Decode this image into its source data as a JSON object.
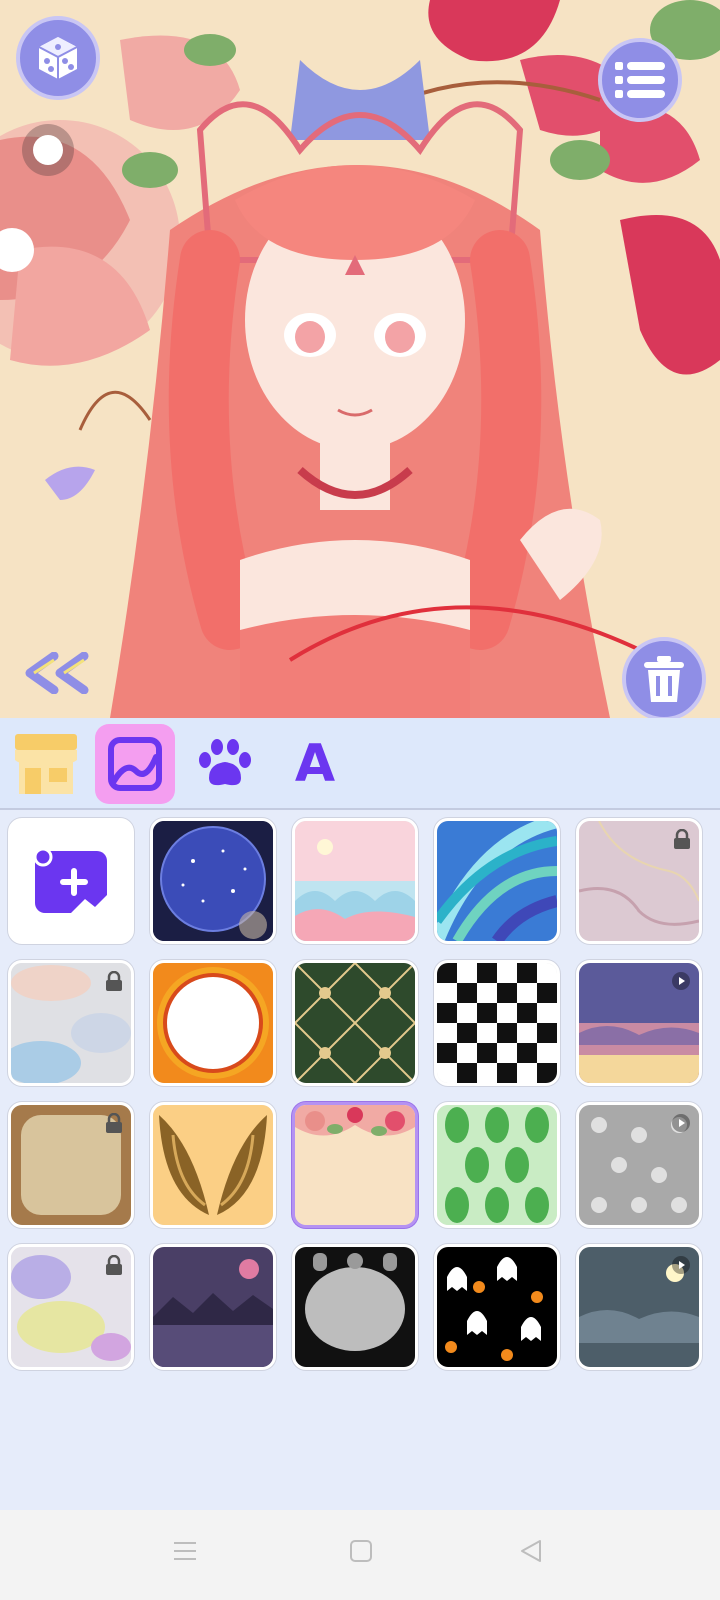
{
  "preview": {
    "dice_icon": "dice-icon",
    "menu_icon": "list-menu-icon",
    "trash_icon": "trash-icon",
    "collapse_icon": "double-chevron-left-icon",
    "toggle_state": "off"
  },
  "tabs": [
    {
      "name": "shop",
      "icon": "shop-icon",
      "active": false
    },
    {
      "name": "backgrounds",
      "icon": "background-image-icon",
      "active": true
    },
    {
      "name": "pets",
      "icon": "paw-icon",
      "active": false
    },
    {
      "name": "text",
      "icon": "letter-a-icon",
      "label": "A",
      "active": false
    }
  ],
  "backgrounds": [
    {
      "id": "upload",
      "kind": "upload-custom",
      "icon": "add-image-icon"
    },
    {
      "id": "galaxy-sphere",
      "locked": false
    },
    {
      "id": "pastel-clouds",
      "locked": false
    },
    {
      "id": "blue-swirl",
      "locked": false
    },
    {
      "id": "pink-marble",
      "locked": true
    },
    {
      "id": "watercolor",
      "locked": true
    },
    {
      "id": "orange-mandala-frame",
      "locked": false
    },
    {
      "id": "green-art-deco",
      "locked": false
    },
    {
      "id": "checkerboard",
      "locked": false
    },
    {
      "id": "sunset-sky",
      "locked": false,
      "video": true
    },
    {
      "id": "old-paper",
      "locked": true
    },
    {
      "id": "golden-wings",
      "locked": false
    },
    {
      "id": "floral-frame",
      "locked": false,
      "selected": true
    },
    {
      "id": "green-leaves",
      "locked": false
    },
    {
      "id": "grey-skulls",
      "locked": false,
      "video": true
    },
    {
      "id": "purple-splash",
      "locked": true
    },
    {
      "id": "night-lake",
      "locked": false
    },
    {
      "id": "graveyard-frame",
      "locked": false
    },
    {
      "id": "halloween-ghosts",
      "locked": false
    },
    {
      "id": "night-clouds",
      "locked": false,
      "video": true
    }
  ],
  "navbar": {
    "recent_icon": "recent-apps-icon",
    "home_icon": "home-icon",
    "back_icon": "back-icon"
  },
  "colors": {
    "accent": "#8f8ee6",
    "active_tab": "#f49ef0",
    "panel": "#e6ecfa",
    "selected_border": "#b592f2"
  }
}
